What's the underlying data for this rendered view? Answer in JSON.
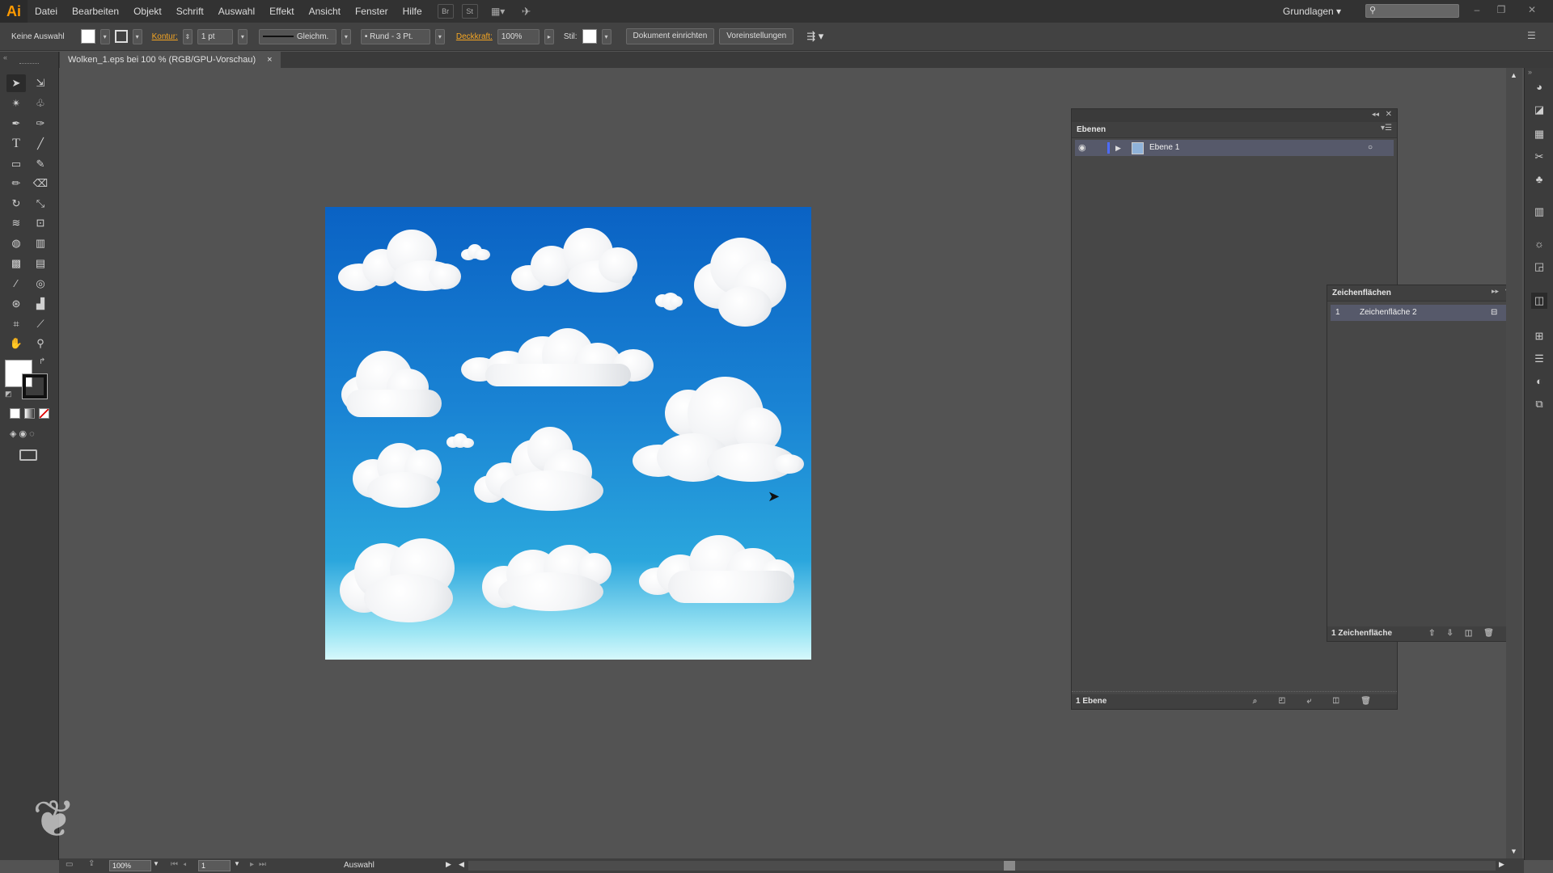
{
  "app": {
    "logo": "Ai"
  },
  "menu": [
    "Datei",
    "Bearbeiten",
    "Objekt",
    "Schrift",
    "Auswahl",
    "Effekt",
    "Ansicht",
    "Fenster",
    "Hilfe"
  ],
  "menubar_icons": {
    "bridge": "Br",
    "stock": "St",
    "arrange": "▦▾",
    "gpu": "✈"
  },
  "workspace": "Grundlagen ▾",
  "search": {
    "value": "",
    "icon": "search-icon"
  },
  "control": {
    "selection": "Keine Auswahl",
    "stroke_label": "Kontur:",
    "stroke_weight": "1 pt",
    "stroke_profile": "Gleichm.",
    "brush": "•  Rund - 3 Pt.",
    "opacity_label": "Deckkraft:",
    "opacity": "100%",
    "style_label": "Stil:",
    "doc_setup": "Dokument einrichten",
    "preferences": "Voreinstellungen"
  },
  "document_tab": {
    "title": "Wolken_1.eps bei 100 % (RGB/GPU-Vorschau)",
    "close": "×"
  },
  "layers_panel": {
    "title": "Ebenen",
    "layer_name": "Ebene 1",
    "footer": "1 Ebene"
  },
  "artboards_panel": {
    "title": "Zeichenflächen",
    "index": "1",
    "artboard_name": "Zeichenfläche 2",
    "footer": "1 Zeichenfläche"
  },
  "status": {
    "zoom": "100%",
    "artboard_number": "1",
    "tool_mode": "Auswahl"
  },
  "colors": {
    "accent": "#f5a623",
    "sky_top": "#0a62c4",
    "sky_bottom": "#d6f8fc",
    "selected_row": "#56596a"
  }
}
